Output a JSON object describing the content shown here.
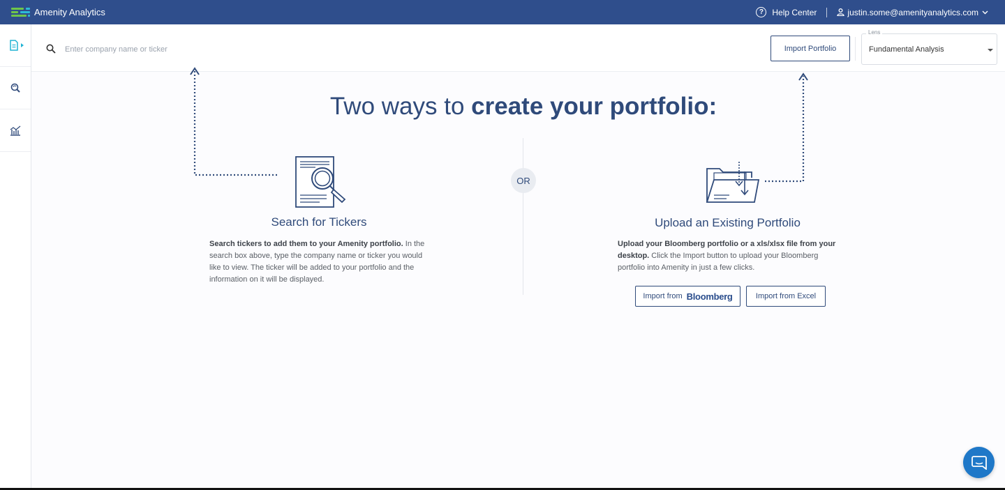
{
  "app": {
    "brand_name": "Amenity Analytics",
    "help_label": "Help Center",
    "user_email": "justin.some@amenityanalytics.com",
    "colors": {
      "topbar": "#2f4e8c",
      "accent": "#2f4a7a",
      "logo_green": "#6fc64a",
      "logo_teal": "#2bbbd6",
      "chat": "#1f78c8"
    }
  },
  "sidebar": {
    "items": [
      {
        "name": "portfolio",
        "icon": "document-icon"
      },
      {
        "name": "search",
        "icon": "search-refresh-icon"
      },
      {
        "name": "analytics",
        "icon": "chart-icon"
      }
    ]
  },
  "search": {
    "placeholder": "Enter company name or ticker",
    "value": ""
  },
  "header": {
    "import_portfolio_label": "Import Portfolio",
    "lens_label": "Lens",
    "lens_value": "Fundamental Analysis"
  },
  "main": {
    "title_light": "Two ways to ",
    "title_bold": "create your portfolio:",
    "or_label": "OR",
    "left": {
      "title": "Search for Tickers",
      "desc_bold": "Search tickers to add them to your Amenity portfolio.",
      "desc_rest": " In the search box above, type the company name or ticker you would like to view. The ticker will be added to your portfolio and the information on it will be displayed."
    },
    "right": {
      "title": "Upload an Existing Portfolio",
      "desc_bold": "Upload your Bloomberg portfolio or a xls/xlsx file from your desktop.",
      "desc_rest": " Click the Import button to upload your Bloomberg portfolio into Amenity in just a few clicks.",
      "import_from_label": "Import from",
      "bloomberg_label": "Bloomberg",
      "import_excel_label": "Import from Excel"
    }
  }
}
